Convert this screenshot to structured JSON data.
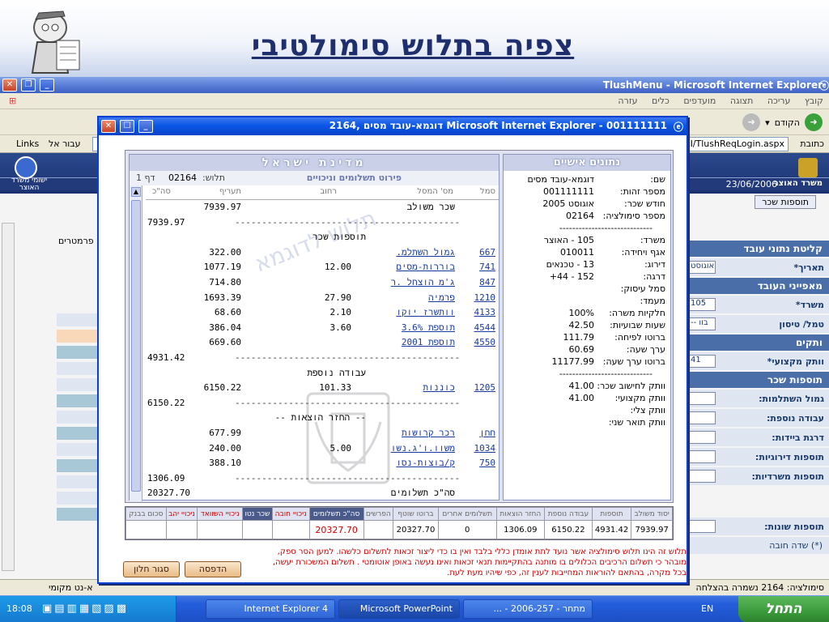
{
  "slide": {
    "title": "צפיה בתלוש סימולטיבי"
  },
  "ie": {
    "title": "TlushMenu - Microsoft Internet Explorer",
    "menu": [
      "קובץ",
      "עריכה",
      "תצוגה",
      "מועדפים",
      "כלים",
      "עזרה"
    ],
    "back_label": "הקודם",
    "address_label": "כתובת",
    "address_value": "I/TlushReqLogin.aspx",
    "go_label": "עבור אל",
    "links_label": "Links",
    "status_text": "סימולציה: 2164 נשמרה בהצלחה",
    "status_zone": "א-נט מקומי"
  },
  "page": {
    "org_name": "משרד האוצר",
    "date": "23/06/2006",
    "right_logo_text": "ישומי משרד האוצר",
    "crumb": "תוספות שכר",
    "left_label": "פרמטרים",
    "form_sections": [
      {
        "title": "קליטת נתוני עובד",
        "rows": [
          {
            "label": "תאריך*",
            "value": "אוגוסט"
          }
        ]
      },
      {
        "title": "מאפייני העובד",
        "rows": [
          {
            "label": "משרד*",
            "value": "105"
          },
          {
            "label": "טמל/ טיסון",
            "value": "-- בוו"
          }
        ]
      },
      {
        "title": "ותקים",
        "rows": [
          {
            "label": "וותק מקצועי*",
            "value": "41"
          }
        ]
      },
      {
        "title": "תוספות שכר",
        "rows": [
          {
            "label": "גמול השתלמות:",
            "value": ""
          },
          {
            "label": "עבודה נוספת:",
            "value": ""
          },
          {
            "label": "דרגת ביידות:",
            "value": ""
          },
          {
            "label": "תוספות דירוגיות:",
            "value": ""
          },
          {
            "label": "תוספות משרדיות:",
            "value": ""
          }
        ]
      },
      {
        "title": "",
        "rows": [
          {
            "label": "תוספות שונות:",
            "value": ""
          }
        ]
      }
    ],
    "required_note": "(*) שדה חובה"
  },
  "popup": {
    "title": "Microsoft Internet Explorer - 001111111 דוגמא-עובד מסים ,2164",
    "left": {
      "header": "מדינת ישראל",
      "subtitle": "פירוט תשלומים וניכויים",
      "tlush_label": "תלוש:",
      "tlush_no": "02164",
      "page_label": "דף 1",
      "watermark": "תלוש לדוגמא",
      "columns": [
        "סמל",
        "מס' המסל",
        "רחוב",
        "תעריף",
        "סה\"כ"
      ],
      "rows": [
        {
          "code": "",
          "desc": "שכר משולב",
          "rate": "",
          "amt": "7939.97",
          "tot": ""
        },
        {
          "code": "",
          "desc": "",
          "rate": "",
          "amt": "",
          "tot": "7939.97",
          "dash": true
        },
        {
          "code": "",
          "desc": "",
          "rate": "",
          "amt": "",
          "tot": "",
          "section": "תוספות שכר"
        },
        {
          "code": "667",
          "desc": "גמול השתלמ.",
          "rate": "",
          "amt": "322.00",
          "tot": ""
        },
        {
          "code": "741",
          "desc": "בוררות-מסים",
          "rate": "12.00",
          "amt": "1077.19",
          "tot": ""
        },
        {
          "code": "847",
          "desc": "ג'מ הוצחל .ר",
          "rate": "",
          "amt": "714.80",
          "tot": ""
        },
        {
          "code": "1210",
          "desc": "פרמיה",
          "rate": "27.90",
          "amt": "1693.39",
          "tot": ""
        },
        {
          "code": "4133",
          "desc": "וותשרז יוקו",
          "rate": "2.10",
          "amt": "68.60",
          "tot": ""
        },
        {
          "code": "4544",
          "desc": "תוספת 3.6%",
          "rate": "3.60",
          "amt": "386.04",
          "tot": ""
        },
        {
          "code": "4550",
          "desc": "תוספת 2001",
          "rate": "",
          "amt": "669.60",
          "tot": ""
        },
        {
          "code": "",
          "desc": "",
          "rate": "",
          "amt": "",
          "tot": "4931.42",
          "dash": true
        },
        {
          "code": "",
          "desc": "",
          "rate": "",
          "amt": "",
          "tot": "",
          "section": "עבודה נוספת"
        },
        {
          "code": "1205",
          "desc": "כוננות",
          "rate": "101.33",
          "amt": "6150.22",
          "tot": ""
        },
        {
          "code": "",
          "desc": "",
          "rate": "",
          "amt": "",
          "tot": "6150.22",
          "dash": true
        },
        {
          "code": "",
          "desc": "",
          "rate": "",
          "amt": "",
          "tot": "",
          "section": "-- החזר הוצאות --"
        },
        {
          "code": "חחן",
          "desc": "רכר קרושות",
          "rate": "",
          "amt": "677.99",
          "tot": ""
        },
        {
          "code": "1034",
          "desc": "משוו.ו'ג.נשו",
          "rate": "5.00",
          "amt": "240.00",
          "tot": ""
        },
        {
          "code": "750",
          "desc": "ק/בוצות-נסו",
          "rate": "",
          "amt": "388.10",
          "tot": ""
        },
        {
          "code": "",
          "desc": "",
          "rate": "",
          "amt": "",
          "tot": "1306.09",
          "dash": true
        },
        {
          "code": "",
          "desc": "סה\"כ תשלומים",
          "rate": "",
          "amt": "",
          "tot": "20327.70"
        }
      ]
    },
    "right": {
      "header": "נתונים אישיים",
      "rows": [
        {
          "k": "שם:",
          "v": "דוגמא-עובד מסים"
        },
        {
          "k": "מספר זהות:",
          "v": "001111111"
        },
        {
          "k": "חודש שכר:",
          "v": "אוגוסט 2005"
        },
        {
          "k": "מספר סימולציה:",
          "v": "02164"
        },
        {
          "k": "",
          "v": "-----------------------------"
        },
        {
          "k": "משרד:",
          "v": "105 - האוצר"
        },
        {
          "k": "אגף ויחידה:",
          "v": "010011"
        },
        {
          "k": "דירוג:",
          "v": "13 - טכנאים"
        },
        {
          "k": "דרגה:",
          "v": "152 - 44+"
        },
        {
          "k": "סמל עיסוק:",
          "v": ""
        },
        {
          "k": "מעמד:",
          "v": ""
        },
        {
          "k": "חלקיות משרה:",
          "v": "100%"
        },
        {
          "k": "שעות שבועיות:",
          "v": "42.50"
        },
        {
          "k": "ברוטו לפיחה:",
          "v": "111.79"
        },
        {
          "k": "ערך שעה:",
          "v": "60.69"
        },
        {
          "k": "ברוטו ערך שעה:",
          "v": "11177.99"
        },
        {
          "k": "",
          "v": "-----------------------------"
        },
        {
          "k": "וותק לחישוב שכר:",
          "v": "41.00"
        },
        {
          "k": "וותק מקצועי:",
          "v": "41.00"
        },
        {
          "k": "וותק צלי:",
          "v": ""
        },
        {
          "k": "וותק תואר שני:",
          "v": ""
        }
      ]
    },
    "summary": {
      "headers": [
        "יסוד משולב",
        "תוספות",
        "עבודה נוספת",
        "החזר הוצאות",
        "תשלומים אחרים",
        "ברוטו שוטף",
        "הפרשים",
        "סה\"כ תשלומים",
        "ניכויי חובה",
        "שכר נטו",
        "ניכויי השוואד",
        "ניכויי יהב",
        "סכום בבנק"
      ],
      "values": [
        "7939.97",
        "4931.42",
        "6150.22",
        "1306.09",
        "0",
        "20327.70",
        "",
        "20327.70",
        "",
        "",
        "",
        "",
        ""
      ]
    },
    "disclaimer": "תלוש זה הינו תלוש סימולציה אשר נועד לתת אומדן כללי בלבד ואין בו כדי ליצור זכאות לתשלום כלשהו. למען הסר ספק, מובהר כי תשלום הרכיבים הכלולים בו מותנה בהתקיימות תנאי זכאות ואינו נעשה באופן אוטומטי . תשלום המשכורת יעשה, בכל מקרה, בהתאם להוראות המחייבות לענין זה, כפי שיהיו מעת לעת.",
    "print_label": "הדפסה",
    "close_label": "סגור חלון"
  },
  "taskbar": {
    "start": "התחל",
    "tasks": [
      "Internet Explorer 4",
      "Microsoft PowerPoint",
      "מתחר - 2006-257 - ..."
    ],
    "lang": "EN",
    "clock": "18:08"
  },
  "colors": {
    "accent": "#0a56e6",
    "title_blue": "#1f2f6e",
    "red": "#cc0000"
  }
}
